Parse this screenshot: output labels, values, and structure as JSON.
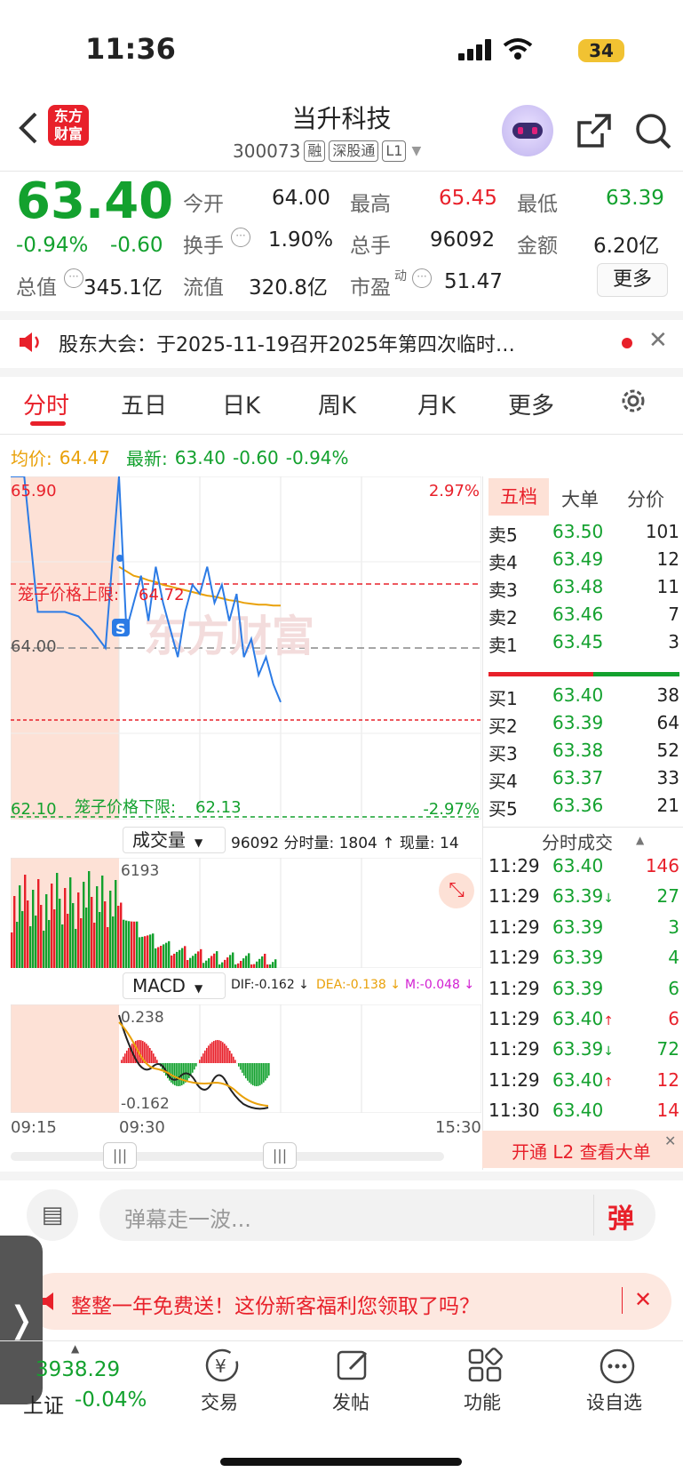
{
  "status": {
    "time": "11:36",
    "battery": "34"
  },
  "header": {
    "name": "当升科技",
    "code": "300073",
    "tags": [
      "融",
      "深股通",
      "L1"
    ],
    "logo": "东方\n财富"
  },
  "quote": {
    "price": "63.40",
    "pct": "-0.94%",
    "chg": "-0.60",
    "open_label": "今开",
    "open": "64.00",
    "high_label": "最高",
    "high": "65.45",
    "low_label": "最低",
    "low": "63.39",
    "turnover_label": "换手",
    "turnover": "1.90%",
    "vol_label": "总手",
    "vol": "96092",
    "amount_label": "金额",
    "amount": "6.20亿",
    "mcap_label": "总值",
    "mcap": "345.1亿",
    "float_label": "流值",
    "float": "320.8亿",
    "pe_label": "市盈",
    "pe_sup": "动",
    "pe": "51.47",
    "more": "更多"
  },
  "notice": "股东大会：于2025-11-19召开2025年第四次临时…",
  "tabs": [
    "分时",
    "五日",
    "日K",
    "周K",
    "月K",
    "更多"
  ],
  "chart_head": {
    "avg_label": "均价:",
    "avg": "64.47",
    "last_label": "最新:",
    "last": "63.40",
    "chg": "-0.60",
    "pct": "-0.94%"
  },
  "chart": {
    "y_top": "65.90",
    "y_mid": "64.00",
    "y_bot": "62.10",
    "pct_top": "2.97%",
    "pct_bot": "-2.97%",
    "upper_label": "笼子价格上限:",
    "upper": "64.72",
    "lower_label": "笼子价格下限:",
    "lower": "62.13",
    "watermark": "东方财富",
    "marker": "S",
    "vol_selector": "成交量",
    "vol_info": "96092 分时量: 1804 ↑ 现量: 14",
    "vol_max": "6193",
    "macd_selector": "MACD",
    "dif": "DIF:-0.162 ↓",
    "dea": "DEA:-0.138 ↓",
    "m": "M:-0.048 ↓",
    "macd_top": "0.238",
    "macd_bot": "-0.162",
    "t1": "09:15",
    "t2": "09:30",
    "t3": "15:30"
  },
  "chart_data": {
    "type": "line",
    "series": [
      {
        "name": "最新",
        "values": [
          65.9,
          65.9,
          64.4,
          64.4,
          64.4,
          64.35,
          64.2,
          64.0,
          65.9,
          64.2,
          64.5,
          64.8,
          64.3,
          64.9,
          64.5,
          64.2,
          63.9,
          64.4,
          64.7,
          64.6,
          64.9,
          64.5,
          64.7,
          64.3,
          64.6,
          63.9,
          64.1,
          63.7,
          63.9,
          63.6,
          63.4
        ]
      },
      {
        "name": "均价",
        "values": [
          null,
          null,
          null,
          null,
          null,
          null,
          null,
          null,
          64.9,
          64.85,
          64.8,
          64.78,
          64.75,
          64.73,
          64.7,
          64.68,
          64.66,
          64.64,
          64.62,
          64.6,
          64.58,
          64.57,
          64.55,
          64.53,
          64.52,
          64.5,
          64.49,
          64.48,
          64.48,
          64.47,
          64.47
        ]
      }
    ],
    "ylim": [
      62.1,
      65.9
    ]
  },
  "orderbook": {
    "tabs": [
      "五档",
      "大单",
      "分价"
    ],
    "sell": [
      [
        "卖5",
        "63.50",
        "101"
      ],
      [
        "卖4",
        "63.49",
        "12"
      ],
      [
        "卖3",
        "63.48",
        "11"
      ],
      [
        "卖2",
        "63.46",
        "7"
      ],
      [
        "卖1",
        "63.45",
        "3"
      ]
    ],
    "buy": [
      [
        "买1",
        "63.40",
        "38"
      ],
      [
        "买2",
        "63.39",
        "64"
      ],
      [
        "买3",
        "63.38",
        "52"
      ],
      [
        "买4",
        "63.37",
        "33"
      ],
      [
        "买5",
        "63.36",
        "21"
      ]
    ]
  },
  "ticks": {
    "title": "分时成交",
    "rows": [
      [
        "11:29",
        "63.40",
        "",
        "146",
        "red"
      ],
      [
        "11:29",
        "63.39",
        "↓",
        "27",
        "green"
      ],
      [
        "11:29",
        "63.39",
        "",
        "3",
        "green"
      ],
      [
        "11:29",
        "63.39",
        "",
        "4",
        "green"
      ],
      [
        "11:29",
        "63.39",
        "",
        "6",
        "green"
      ],
      [
        "11:29",
        "63.40",
        "↑",
        "6",
        "red"
      ],
      [
        "11:29",
        "63.39",
        "↓",
        "72",
        "green"
      ],
      [
        "11:29",
        "63.40",
        "↑",
        "12",
        "red"
      ],
      [
        "11:30",
        "63.40",
        "",
        "14",
        "red"
      ]
    ],
    "l2": "开通 L2 查看大单"
  },
  "comment": {
    "placeholder": "弹幕走一波...",
    "btn": "弹"
  },
  "ad": "整整一年免费送！这份新客福利您领取了吗？",
  "bottom": {
    "index_val": "3938.29",
    "index_name": "上证",
    "index_pct": "-0.04%",
    "items": [
      "交易",
      "发帖",
      "功能",
      "设自选"
    ]
  }
}
